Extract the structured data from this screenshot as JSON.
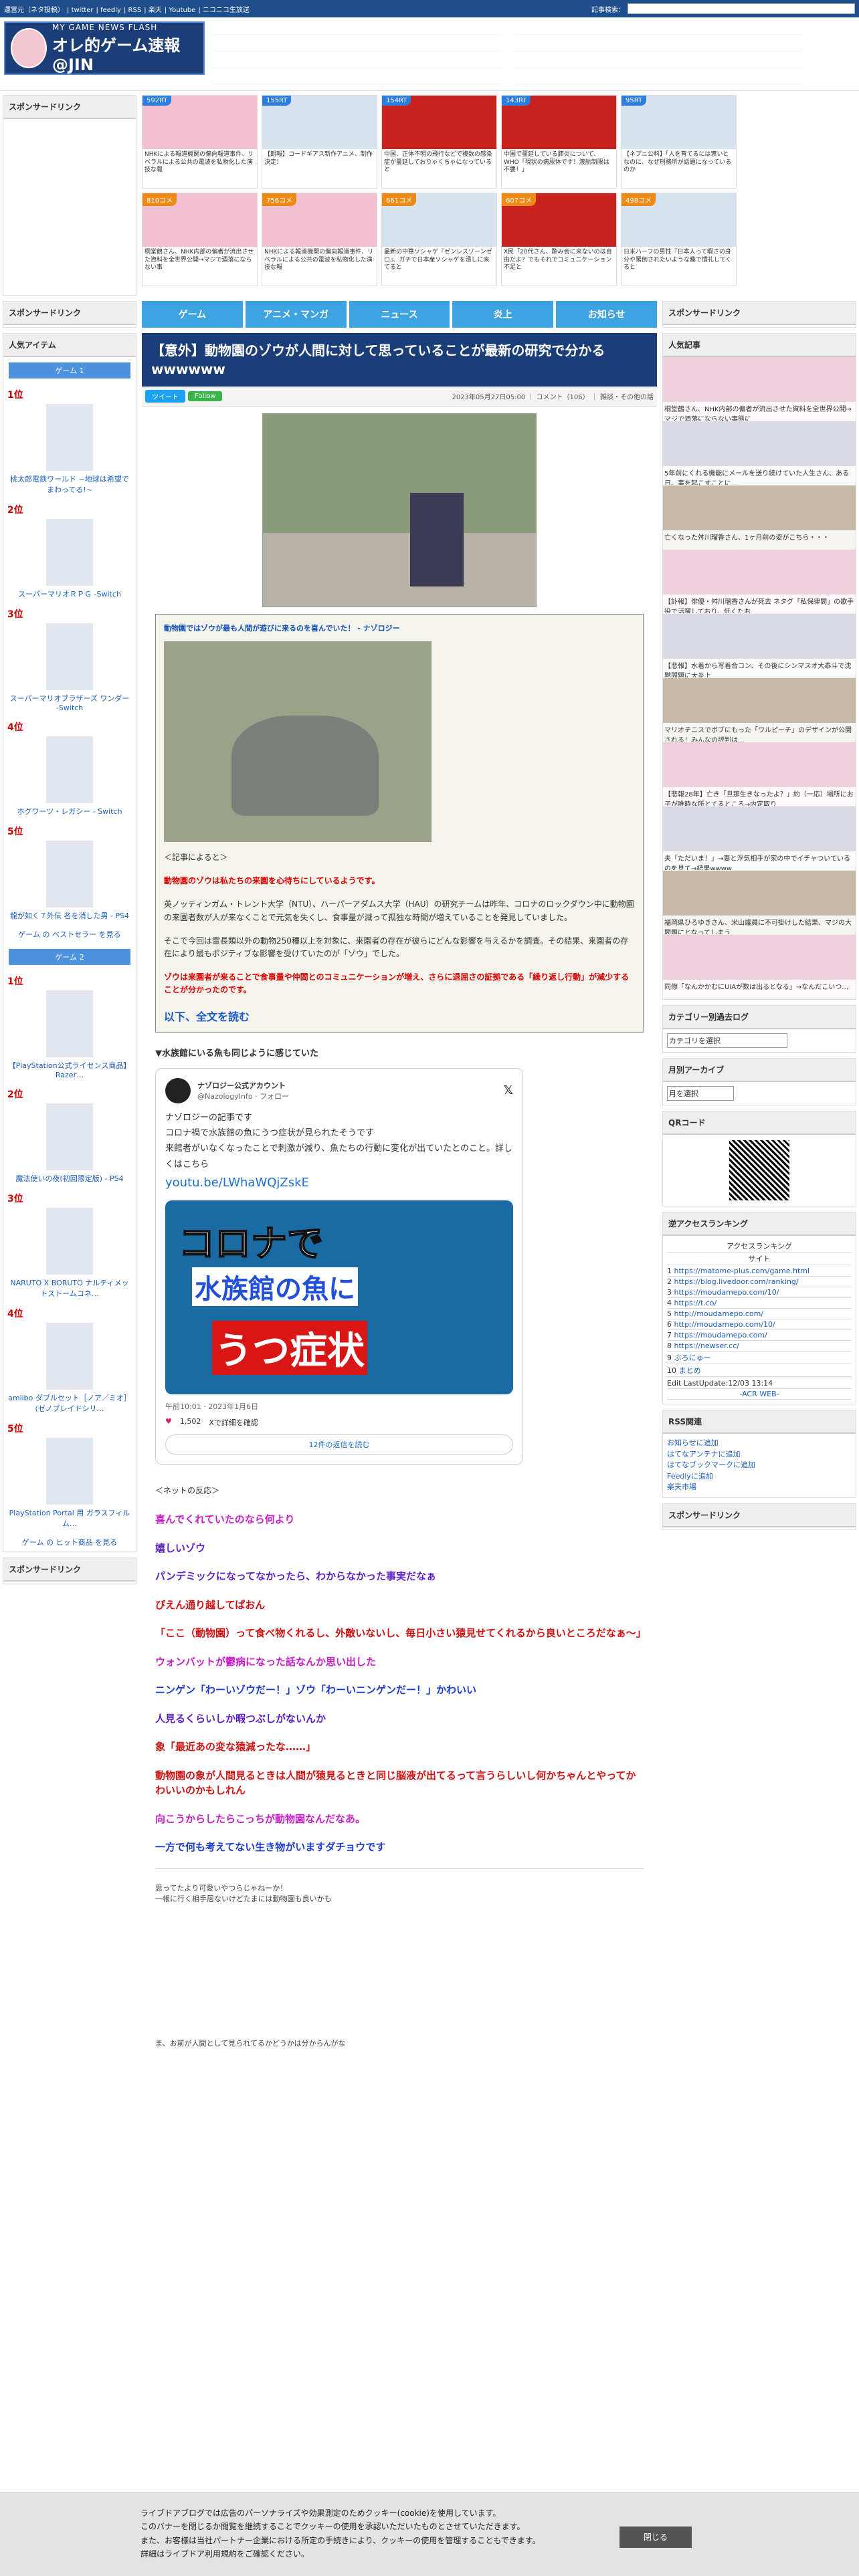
{
  "topbar": {
    "links": [
      "運営元（ネタ投稿）",
      "twitter",
      "feedly",
      "RSS",
      "楽天",
      "Youtube",
      "ニコニコ生放送"
    ],
    "search_label": "記事検索："
  },
  "logo": {
    "tagline": "MY GAME NEWS FLASH",
    "name": "オレ的ゲーム速報@JIN"
  },
  "sidebar_sponsor": "スポンサードリンク",
  "thumbs": [
    {
      "badge": "592RT",
      "text": "NHKによる報道機関の偏向報道事件、リベラルによる公共の電波を私物化した演技な報"
    },
    {
      "badge": "155RT",
      "text": "【朗報】コードギアス新作アニメ、制作決定！"
    },
    {
      "badge": "154RT",
      "text": "中国、正体不明の飛行などで複数の感染症が蔓延しておりゃくちゃになっていると"
    },
    {
      "badge": "143RT",
      "text": "中国で蔓延している肺炎について、WHO「現状の病原体です！渡航制限は不要！」"
    },
    {
      "badge": "95RT",
      "text": "【ネプニ公料】「人を育てるには褒いとなのに、なぜ刑務所が話題になっているのか"
    },
    {
      "badge": "810コメ",
      "text": "桐堂鶴さん、NHK内部の偏者が流出させた資料を全世界公開→マジで酒落にならない事"
    },
    {
      "badge": "756コメ",
      "text": "NHKによる報道機関の偏向報道事件、リベラルによる公共の電波を私物化した演技な報"
    },
    {
      "badge": "661コメ",
      "text": "最新の中華ソシャゲ『ゼンレスゾーンゼロ』、ガチで日本産ソシャゲを潰しに来てると"
    },
    {
      "badge": "607コメ",
      "text": "X民「20代さん、酔み会に来ないのは自由だよ？でもそれでコミュニケーション不足と"
    },
    {
      "badge": "498コメ",
      "text": "日米ハーフの男性『日本人って暇さの身分や罵倒されたいような趣で慣礼してくると"
    }
  ],
  "nav": [
    "ゲーム",
    "アニメ・マンガ",
    "ニュース",
    "炎上",
    "お知らせ"
  ],
  "article": {
    "title": "【意外】動物園のゾウが人間に対して思っていることが最新の研究で分かるwwwwww",
    "tweet_btn": "ツイート",
    "follow_btn": "Follow",
    "meta": "2023年05月27日05:00 ｜ コメント（106） ｜ 雑談・その他の話",
    "quote_title": "動物園ではゾウが最も人間が遊びに来るのを喜んでいた！ - ナゾロジー",
    "quote_intro": "＜記事によると＞",
    "p1": "動物園のゾウは私たちの来園を心待ちにしているようです。",
    "p2": "英ノッティンガム・トレント大学（NTU）、ハーパーアダムス大学（HAU）の研究チームは昨年、コロナのロックダウン中に動物園の来園者数が人が来なくことで元気を失くし、食事量が減って孤独な時間が増えていることを発見していました。",
    "p3": "そこで今回は霊長類以外の動物250種以上を対象に、来園者の存在が彼らにどんな影響を与えるかを調査。その結果、来園者の存在により最もポジティブな影響を受けていたのが「ゾウ」でした。",
    "p4": "ゾウは来園者が来ることで食事量や仲間とのコミュニケーションが増え、さらに退屈さの証拠である「繰り返し行動」が減少することが分かったのです。",
    "more": "以下、全文を読む",
    "related": "▼水族館にいる魚も同じように感じていた"
  },
  "tweet": {
    "name": "ナゾロジー公式アカウント",
    "handle": "@NazologyInfo · フォロー",
    "sub": "ナゾロジーの記事です",
    "line1": "コロナ禍で水族館の魚にうつ症状が見られたそうです",
    "line2": "来館者がいなくなったことで刺激が減り、魚たちの行動に変化が出ていたとのこと。詳しくはこちら",
    "link": "youtu.be/LWhaWQjZskE",
    "pic_top": "コロナで",
    "pic_mid": "水族館の魚に",
    "pic_bot": "うつ症状",
    "time": "午前10:01 · 2023年1月6日",
    "likes": "1,502",
    "likes_note": "Xで詳細を確認",
    "replies": "12件の返信を読む"
  },
  "comments_head": "＜ネットの反応＞",
  "comments": [
    {
      "t": "喜んでくれていたのなら何より",
      "c": "c-mag"
    },
    {
      "t": "嬉しいゾウ",
      "c": "c-pur"
    },
    {
      "t": "パンデミックになってなかったら、わからなかった事実だなぁ",
      "c": "c-pur"
    },
    {
      "t": "ぴえん通り越してぱおん",
      "c": "c-red"
    },
    {
      "t": "「ここ（動物園）って食べ物くれるし、外敵いないし、毎日小さい猿見せてくれるから良いところだなぁ～」",
      "c": "c-red"
    },
    {
      "t": "ウォンバットが鬱病になった話なんか思い出した",
      "c": "c-mag"
    },
    {
      "t": "ニンゲン「わーいゾウだー！」ゾウ「わーいニンゲンだー！」かわいい",
      "c": "c-blu"
    },
    {
      "t": "人見るくらいしか暇つぶしがないんか",
      "c": "c-pur"
    },
    {
      "t": "象「最近あの変な猿減ったな……」",
      "c": "c-red"
    },
    {
      "t": "動物園の象が人間見るときは人間が猿見るときと同じ脳液が出てるって言うらしいし何かちゃんとやってかわいいのかもしれん",
      "c": "c-red"
    },
    {
      "t": "向こうからしたらこっちが動物園なんだなあ。",
      "c": "c-mag"
    },
    {
      "t": "一方で何も考えてない生き物がいますダチョウです",
      "c": "c-blu"
    }
  ],
  "aa": {
    "l1": "思ってたより可愛いやつらじゃねーか！",
    "l2": "一帳に行く相手居ないけどたまには動物園も良いかも",
    "l3": "ま、お前が人間として見られてるかどうかは分からんがな"
  },
  "left": {
    "items_head": "人気アイテム",
    "game1": "ゲーム 1",
    "game2": "ゲーム 2",
    "r1": [
      {
        "n": "1位",
        "t": "桃太郎電鉄ワールド ~地球は希望でまわってる!~"
      },
      {
        "n": "2位",
        "t": "スーパーマリオＲＰＧ -Switch"
      },
      {
        "n": "3位",
        "t": "スーパーマリオブラザーズ ワンダー -Switch"
      },
      {
        "n": "4位",
        "t": "ホグワーツ・レガシー - Switch"
      },
      {
        "n": "5位",
        "t": "龍が如く７外伝 名を消した男 - PS4"
      }
    ],
    "r1more": "ゲーム の ベストセラー を見る",
    "r2": [
      {
        "n": "1位",
        "t": "【PlayStation公式ライセンス商品】Razer…"
      },
      {
        "n": "2位",
        "t": "魔法使いの夜(初回限定版) - PS4"
      },
      {
        "n": "3位",
        "t": "NARUTO X BORUTO ナルティメットストームコネ…"
      },
      {
        "n": "4位",
        "t": "amiibo ダブルセット［ノア／ミオ］(ゼノブレイドシリ…"
      },
      {
        "n": "5位",
        "t": "PlayStation Portal 用 ガラスフィルム…"
      }
    ],
    "r2more": "ゲーム の ヒット商品 を見る"
  },
  "right": {
    "pop_head": "人気記事",
    "pop": [
      "桐堂鶴さん、NHK内部の偏者が流出させた資料を全世界公開→マジで酒落にならない事態に",
      "5年前にくれる機能にメールを送り続けていた人生さん、ある日、事を起こすことに…",
      "亡くなった舛川瑠香さん、1ヶ月前の姿がこちら・・・",
      "【訃報】俳優・舛川瑠香さんが死去 ネタグ「私保律問」の歌手役で活躍しており、低くたお",
      "【悲報】水着から写着合コン、その後にシンマスオ大泰斗で沈黙問題に大炎上",
      "マリオチニスでボブにもった「ワルピーチ」のデザインが公開される！みんなの評判は…",
      "【悲報28年】亡き「旦那生きなったよ？」約（一応）場所にお子が唯時な所とてるところ→内定取り",
      "夫「ただいま！」→妻と浮気相手が家の中でイチャついているのを見て→結果wwww",
      "福岡県ひろゆきさん、米山議員に不可掛けした結果、マジの大問題にとなってしまう",
      "同僚「なんかかむにUIAが数は出るとなる」→なんだこいつ…"
    ],
    "cat_head": "カテゴリー別過去ログ",
    "cat_sel": "カテゴリを選択",
    "mon_head": "月別アーカイブ",
    "mon_sel": "月を選択",
    "qr_head": "QRコード",
    "acc_head": "逆アクセスランキング",
    "acc_title": "アクセスランキング",
    "acc_site": "サイト",
    "acc": [
      "https://matome-plus.com/game.html",
      "https://blog.livedoor.com/ranking/",
      "https://moudamepo.com/10/",
      "https://t.co/",
      "http://moudamepo.com/",
      "http://moudamepo.com/10/",
      "https://moudamepo.com/",
      "https://newser.cc/",
      "ぶろにゅー",
      "まとめ"
    ],
    "acc_upd": "Edit LastUpdate:12/03 13:14",
    "acc_foot": "-ACR WEB-",
    "rss_head": "RSS関連",
    "rss": [
      "お知らせに追加",
      "はてなアンテナに追加",
      "はてなブックマークに追加",
      "Feedlyに追加",
      "楽天市場"
    ],
    "sponsor": "スポンサードリンク"
  },
  "cookie": {
    "l1": "ライブドアブログでは広告のパーソナライズや効果測定のためクッキー(cookie)を使用しています。",
    "l2": "このバナーを閉じるか閲覧を継続することでクッキーの使用を承認いただいたものとさせていただきます。",
    "l3": "また、お客様は当社パートナー企業における所定の手続きにより、クッキーの使用を管理することもできます。",
    "l4": "詳細はライブドア利用規約をご確認ください。",
    "close": "閉じる"
  }
}
